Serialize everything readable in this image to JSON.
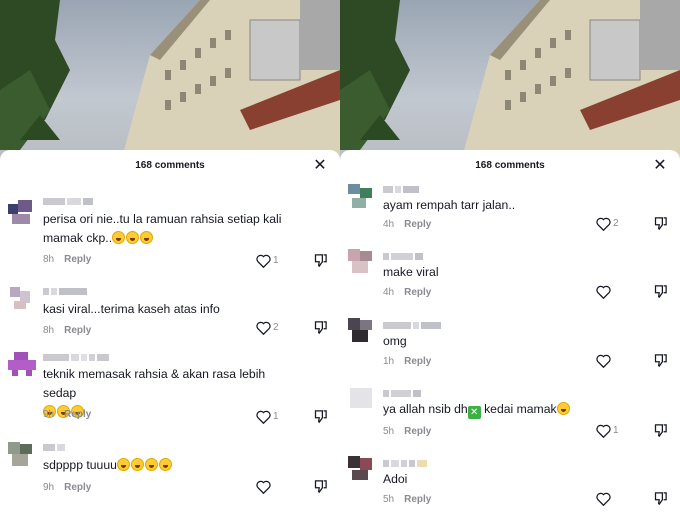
{
  "left_panel": {
    "comment_count": "168 comments",
    "comments": [
      {
        "text": "perisa ori nie..tu la ramuan rahsia setiap kali mamak ckp..",
        "emojis": 3,
        "time": "8h",
        "reply": "Reply",
        "likes": "1"
      },
      {
        "text": "kasi viral...terima kaseh atas info",
        "emojis": 0,
        "time": "8h",
        "reply": "Reply",
        "likes": "2"
      },
      {
        "text": "teknik memasak rahsia & akan rasa lebih sedap",
        "emojis": 3,
        "time": "9h",
        "reply": "Reply",
        "likes": "1"
      },
      {
        "text": "sdpppp tuuuu",
        "emojis": 4,
        "time": "9h",
        "reply": "Reply",
        "likes": ""
      }
    ]
  },
  "right_panel": {
    "comment_count": "168 comments",
    "comments": [
      {
        "text": "ayam rempah tarr jalan..",
        "time": "4h",
        "reply": "Reply",
        "likes": "2"
      },
      {
        "text": "make viral",
        "time": "4h",
        "reply": "Reply",
        "likes": ""
      },
      {
        "text": "omg",
        "time": "1h",
        "reply": "Reply",
        "likes": ""
      },
      {
        "text_before": "ya allah nsib dh",
        "text_after": " kedai mamak",
        "time": "5h",
        "reply": "Reply",
        "likes": "1"
      },
      {
        "text": "Adoi",
        "time": "5h",
        "reply": "Reply",
        "likes": ""
      }
    ]
  },
  "colors": {
    "text": "#161823",
    "muted": "#8a8b91",
    "emoji": "#ffcc33",
    "check_box": "#3cb043"
  },
  "icons": [
    "close-icon",
    "heart-icon",
    "dislike-icon",
    "grin-emoji",
    "cross-mark-emoji"
  ]
}
